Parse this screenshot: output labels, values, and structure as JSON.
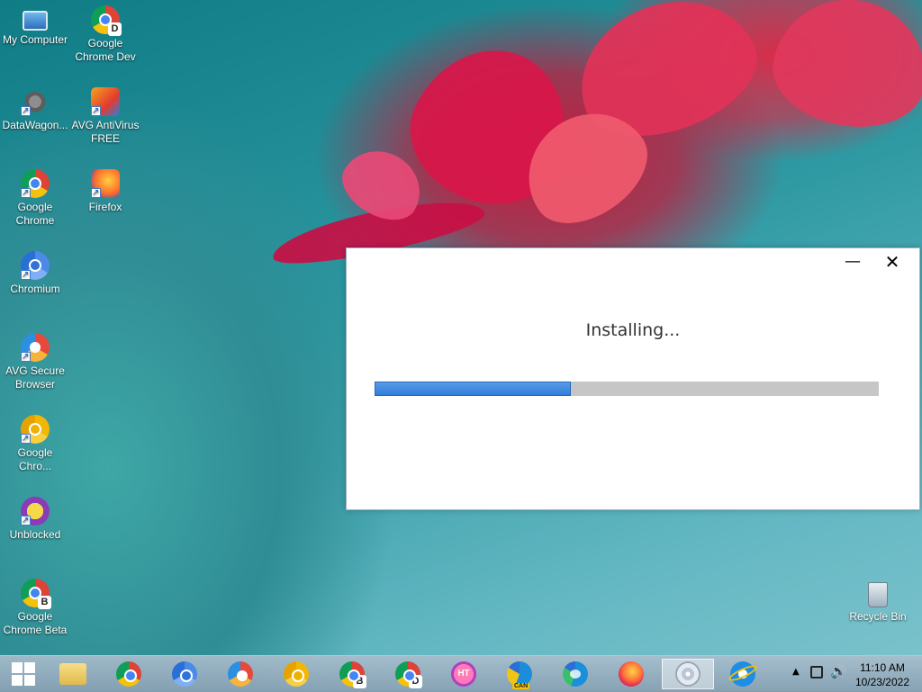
{
  "desktop": {
    "icons": [
      {
        "label": "My Computer",
        "icon": "computer-icon"
      },
      {
        "label": "Google Chrome Dev",
        "icon": "chrome-dev-icon",
        "badge": "D"
      },
      {
        "label": "DataWagon...",
        "icon": "gear-icon"
      },
      {
        "label": "AVG AntiVirus FREE",
        "icon": "avg-antivirus-icon"
      },
      {
        "label": "Google Chrome",
        "icon": "chrome-icon"
      },
      {
        "label": "Firefox",
        "icon": "firefox-icon"
      },
      {
        "label": "Chromium",
        "icon": "chromium-icon"
      },
      {
        "label": "AVG Secure Browser",
        "icon": "avg-secure-browser-icon"
      },
      {
        "label": "Google Chro...",
        "icon": "chrome-canary-icon"
      },
      {
        "label": "Unblocked",
        "icon": "unblocked-icon"
      },
      {
        "label": "Google Chrome Beta",
        "icon": "chrome-beta-icon",
        "badge": "B"
      },
      {
        "label": "Recycle Bin",
        "icon": "recycle-bin-icon"
      }
    ]
  },
  "installer": {
    "status": "Installing...",
    "progress": 0.39,
    "minimize_glyph": "—",
    "close_glyph": "✕"
  },
  "taskbar": {
    "items": [
      {
        "name": "start-button",
        "icon": "windows-icon"
      },
      {
        "name": "file-explorer",
        "icon": "folder-icon"
      },
      {
        "name": "google-chrome",
        "icon": "chrome-icon"
      },
      {
        "name": "chromium",
        "icon": "chromium-icon"
      },
      {
        "name": "avg-secure-browser",
        "icon": "avg-secure-browser-icon"
      },
      {
        "name": "chrome-canary",
        "icon": "chrome-canary-icon"
      },
      {
        "name": "chrome-beta",
        "icon": "chrome-beta-icon",
        "badge": "B"
      },
      {
        "name": "chrome-dev",
        "icon": "chrome-dev-icon",
        "badge": "D"
      },
      {
        "name": "unblocked",
        "icon": "unblocked-icon",
        "badge": "HT"
      },
      {
        "name": "edge-canary",
        "icon": "edge-canary-icon",
        "badge": "CAN"
      },
      {
        "name": "edge",
        "icon": "edge-icon"
      },
      {
        "name": "firefox",
        "icon": "firefox-icon"
      },
      {
        "name": "installer-setup",
        "icon": "dvd-setup-icon",
        "active": true
      },
      {
        "name": "internet-explorer",
        "icon": "internet-explorer-icon"
      }
    ],
    "tray": {
      "time": "11:10 AM",
      "date": "10/23/2022"
    }
  }
}
